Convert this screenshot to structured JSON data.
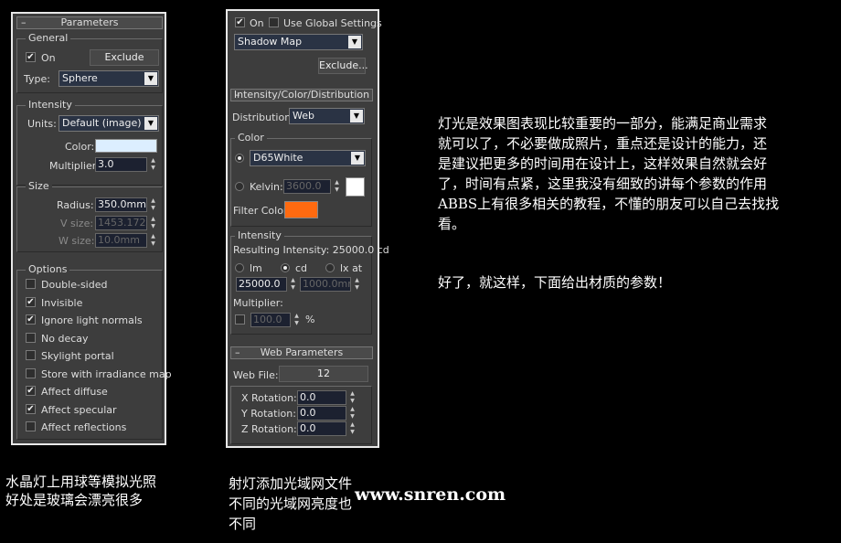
{
  "panel1": {
    "rollout_title": "Parameters",
    "general": {
      "label": "General",
      "on_label": "On",
      "on_checked": true,
      "exclude_button": "Exclude",
      "type_label": "Type:",
      "type_value": "Sphere"
    },
    "intensity": {
      "label": "Intensity",
      "units_label": "Units:",
      "units_value": "Default (image)",
      "color_label": "Color:",
      "color_value": "#dceeff",
      "multiplier_label": "Multiplier:",
      "multiplier_value": "3.0"
    },
    "size": {
      "label": "Size",
      "radius_label": "Radius:",
      "radius_value": "350.0mm",
      "vsize_label": "V size:",
      "vsize_value": "1453.172",
      "wsize_label": "W size:",
      "wsize_value": "10.0mm"
    },
    "options": {
      "label": "Options",
      "items": [
        {
          "label": "Double-sided",
          "checked": false
        },
        {
          "label": "Invisible",
          "checked": true
        },
        {
          "label": "Ignore light normals",
          "checked": true
        },
        {
          "label": "No decay",
          "checked": false
        },
        {
          "label": "Skylight portal",
          "checked": false
        },
        {
          "label": "Store with irradiance map",
          "checked": false
        },
        {
          "label": "Affect diffuse",
          "checked": true
        },
        {
          "label": "Affect specular",
          "checked": true
        },
        {
          "label": "Affect reflections",
          "checked": false
        }
      ]
    }
  },
  "panel2": {
    "on_label": "On",
    "use_global_label": "Use Global Settings",
    "shadow_type": "Shadow Map",
    "exclude_button": "Exclude...",
    "rollout_title": "Intensity/Color/Distribution",
    "distribution_label": "Distribution:",
    "distribution_value": "Web",
    "color_group": "Color",
    "color_preset": "D65White",
    "kelvin_label": "Kelvin:",
    "kelvin_value": "3600.0",
    "kelvin_swatch": "#ffffff",
    "filter_color_label": "Filter Color:",
    "filter_color_value": "#ff6a10",
    "intensity_group": "Intensity",
    "resulting_intensity": "Resulting Intensity: 25000.0 cd",
    "unit_lm": "lm",
    "unit_cd": "cd",
    "unit_lx": "lx at",
    "intensity_value": "25000.0",
    "distance_value": "1000.0mr",
    "multiplier_label": "Multiplier:",
    "multiplier_value": "100.0",
    "percent": "%",
    "web_rollout_title": "Web Parameters",
    "web_file_label": "Web File:",
    "web_file_value": "12",
    "x_rotation_label": "X Rotation:",
    "x_rotation_value": "0.0",
    "y_rotation_label": "Y Rotation:",
    "y_rotation_value": "0.0",
    "z_rotation_label": "Z Rotation:",
    "z_rotation_value": "0.0"
  },
  "captions": {
    "left_line1": "水晶灯上用球等模拟光照",
    "left_line2": "好处是玻璃会漂亮很多",
    "mid_line1": "射灯添加光域网文件",
    "mid_line2": "不同的光域网亮度也",
    "mid_line3": "不同",
    "site": "www.snren.com"
  },
  "right_text": {
    "line1": "灯光是效果图表现比较重要的一部分，能满足商业需求",
    "line2": "就可以了，不必要做成照片，重点还是设计的能力，还",
    "line3": "是建议把更多的时间用在设计上，这样效果自然就会好",
    "line4": "了，时间有点紧，这里我没有细致的讲每个参数的作用",
    "line5": "ABBS上有很多相关的教程，不懂的朋友可以自己去找找",
    "line6": "看。",
    "closing": "好了，就这样，下面给出材质的参数！"
  }
}
